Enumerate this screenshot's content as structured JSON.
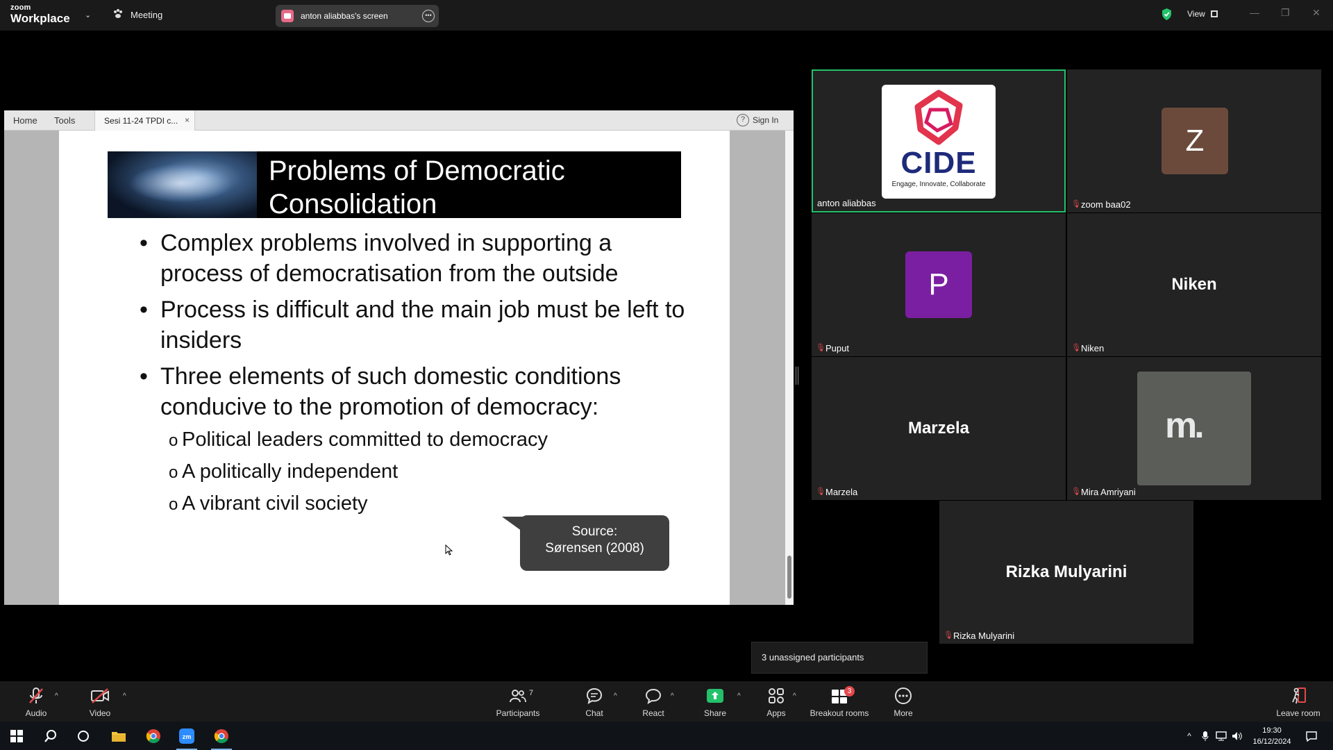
{
  "titlebar": {
    "brand_top": "zoom",
    "brand_bottom": "Workplace",
    "meeting_label": "Meeting",
    "screen_tab_label": "anton aliabbas's screen",
    "view_label": "View"
  },
  "shared_screen": {
    "viewer": {
      "home": "Home",
      "tools": "Tools",
      "tab_label": "Sesi 11-24 TPDI c...",
      "tab_close": "×",
      "help": "?",
      "sign_in": "Sign In"
    },
    "slide": {
      "title": "Problems of Democratic Consolidation",
      "bullets": [
        "Complex problems involved in supporting a process of democratisation from the outside",
        "Process is difficult and the main job must be left to insiders",
        "Three elements of such domestic conditions conducive to the promotion of democracy:"
      ],
      "sub_bullets": [
        "Political leaders committed to democracy",
        "A politically independent",
        "A vibrant civil society"
      ],
      "callout_line1": "Source:",
      "callout_line2": "Sørensen (2008)"
    }
  },
  "gallery": {
    "tiles": [
      {
        "name": "anton aliabbas",
        "muted": false,
        "logo": "CIDE",
        "tagline": "Engage, Innovate, Collaborate"
      },
      {
        "name": "zoom baa02",
        "muted": true,
        "avatar_letter": "Z",
        "avatar_color": "#6b4a3c"
      },
      {
        "name": "Puput",
        "muted": true,
        "avatar_letter": "P",
        "avatar_color": "#7b1fa2"
      },
      {
        "name": "Niken",
        "muted": true,
        "display_name": "Niken"
      },
      {
        "name": "Marzela",
        "muted": true,
        "display_name": "Marzela"
      },
      {
        "name": "Mira Amriyani",
        "muted": true,
        "logo": "m."
      },
      {
        "name": "Rizka Mulyarini",
        "muted": true,
        "display_name": "Rizka Mulyarini"
      }
    ],
    "unassigned_text": "3 unassigned participants"
  },
  "toolbar": {
    "audio": "Audio",
    "video": "Video",
    "participants": "Participants",
    "participants_count": "7",
    "chat": "Chat",
    "react": "React",
    "share": "Share",
    "apps": "Apps",
    "breakout": "Breakout rooms",
    "breakout_badge": "3",
    "more": "More",
    "leave": "Leave room"
  },
  "taskbar": {
    "time": "19:30",
    "date": "16/12/2024"
  },
  "colors": {
    "active_speaker_border": "#23c26b",
    "share_green": "#24c16b",
    "mute_red": "#e04a4a",
    "badge_red": "#e5484d"
  }
}
